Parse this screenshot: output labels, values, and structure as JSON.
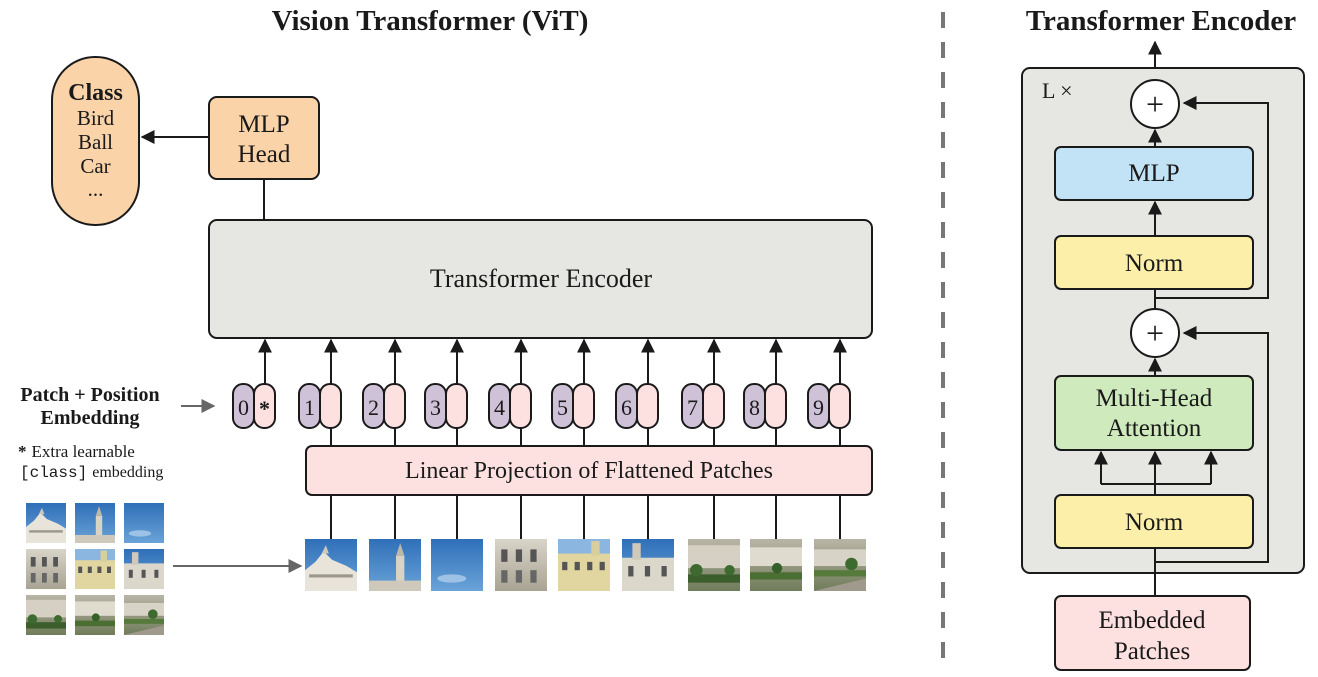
{
  "colors": {
    "ink": "#1a1a1a",
    "orange": "#fbd3a8",
    "gray_box": "#e6e7e3",
    "pink": "#fde1e1",
    "purple": "#cfc2d8",
    "blue": "#c2e3f6",
    "yellow": "#fbefa9",
    "green": "#cfebbd",
    "arrow_gray": "#666666",
    "dash": "#777777"
  },
  "vit": {
    "title": "Vision Transformer (ViT)",
    "class_box": {
      "title": "Class",
      "items": [
        "Bird",
        "Ball",
        "Car",
        "..."
      ]
    },
    "mlp_head": {
      "line1": "MLP",
      "line2": "Head"
    },
    "encoder_label": "Transformer Encoder",
    "projection_label": "Linear Projection of Flattened Patches",
    "embedding_label": {
      "line1": "Patch + Position",
      "line2": "Embedding"
    },
    "note": {
      "star": "*",
      "line1": "Extra learnable",
      "line2_code": "[class]",
      "line2_rest": "embedding"
    },
    "tokens": [
      {
        "pos": "0",
        "patch": "*"
      },
      {
        "pos": "1",
        "patch": ""
      },
      {
        "pos": "2",
        "patch": ""
      },
      {
        "pos": "3",
        "patch": ""
      },
      {
        "pos": "4",
        "patch": ""
      },
      {
        "pos": "5",
        "patch": ""
      },
      {
        "pos": "6",
        "patch": ""
      },
      {
        "pos": "7",
        "patch": ""
      },
      {
        "pos": "8",
        "patch": ""
      },
      {
        "pos": "9",
        "patch": ""
      }
    ]
  },
  "encoder_detail": {
    "title": "Transformer Encoder",
    "repeat_label": "L ×",
    "plus_symbol": "+",
    "mlp_label": "MLP",
    "norm_label": "Norm",
    "attention": {
      "line1": "Multi-Head",
      "line2": "Attention"
    },
    "input": {
      "line1": "Embedded",
      "line2": "Patches"
    }
  }
}
